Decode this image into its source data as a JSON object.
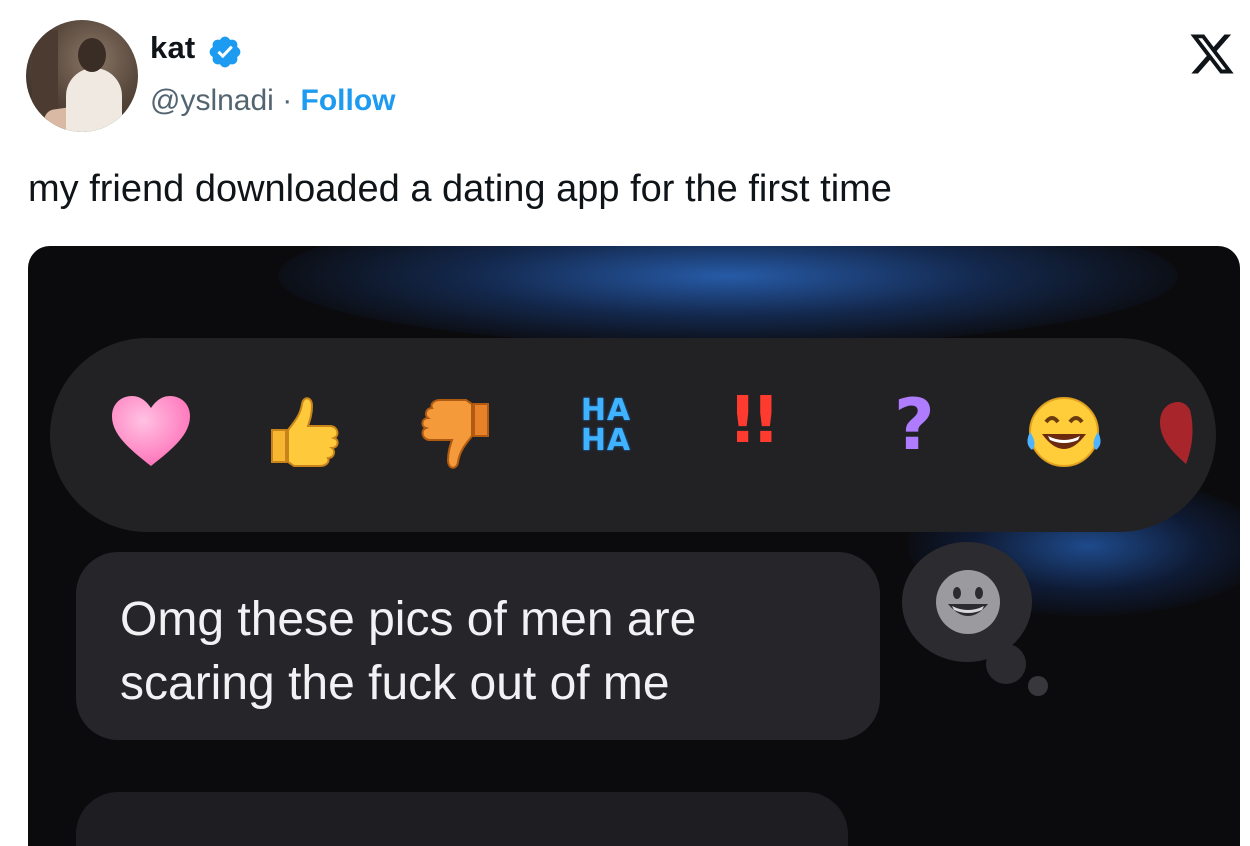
{
  "header": {
    "display_name": "kat",
    "handle": "@yslnadi",
    "separator": "·",
    "follow_label": "Follow",
    "verified": true
  },
  "tweet": {
    "text": "my friend downloaded a dating app for the first time"
  },
  "media": {
    "reactions": [
      "heart",
      "thumbs-up",
      "thumbs-down",
      "haha",
      "exclamation",
      "question",
      "laughing-face",
      "red-heart-partial"
    ],
    "haha_line1": "HA",
    "haha_line2": "HA",
    "exclamation_text": "!!",
    "question_text": "?",
    "message_text": "Omg these pics of men are scaring the fuck out of me"
  },
  "colors": {
    "follow_blue": "#1d9bf0",
    "verified_blue": "#1d9bf0",
    "bubble_bg": "#26262a",
    "reaction_bar_bg": "#222225"
  }
}
